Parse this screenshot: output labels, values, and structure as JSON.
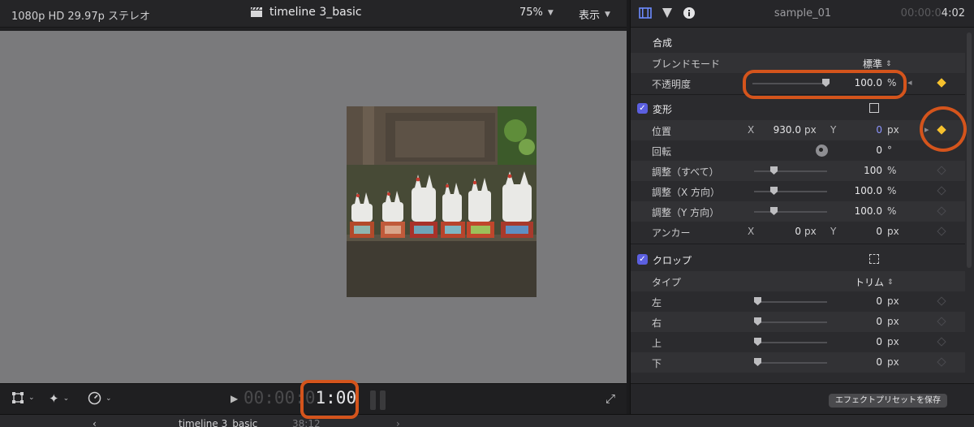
{
  "viewer": {
    "format": "1080p HD 29.97p ステレオ",
    "project_title": "timeline 3_basic",
    "zoom": "75%",
    "view_menu": "表示",
    "timecode_dim": "00:00:0",
    "timecode_bright": "1:00"
  },
  "inspector": {
    "clip_name": "sample_01",
    "duration_dim": "00:00:0",
    "duration_bright": "4:02",
    "compositing": {
      "title": "合成",
      "blend_label": "ブレンドモード",
      "blend_value": "標準",
      "opacity_label": "不透明度",
      "opacity_value": "100.0",
      "opacity_unit": "%"
    },
    "transform": {
      "title": "変形",
      "position_label": "位置",
      "x_axis": "X",
      "y_axis": "Y",
      "pos_x": "930.0",
      "pos_y": "0",
      "px": "px",
      "rotation_label": "回転",
      "rotation_value": "0",
      "deg": "°",
      "scale_all_label": "調整（すべて）",
      "scale_all_value": "100",
      "scale_x_label": "調整（X 方向）",
      "scale_x_value": "100.0",
      "scale_y_label": "調整（Y 方向）",
      "scale_y_value": "100.0",
      "pct": "%",
      "anchor_label": "アンカー",
      "anchor_x": "0",
      "anchor_y": "0"
    },
    "crop": {
      "title": "クロップ",
      "type_label": "タイプ",
      "type_value": "トリム",
      "left_label": "左",
      "right_label": "右",
      "top_label": "上",
      "bottom_label": "下",
      "left_value": "0",
      "right_value": "0",
      "top_value": "0",
      "bottom_value": "0"
    },
    "save_preset": "エフェクトプリセットを保存"
  },
  "timeline": {
    "project_title": "timeline 3_basic",
    "duration": "38:12"
  },
  "colors": {
    "highlight": "#d4541c",
    "keyframe": "#f6c12e",
    "checkbox": "#5b5fe0"
  }
}
